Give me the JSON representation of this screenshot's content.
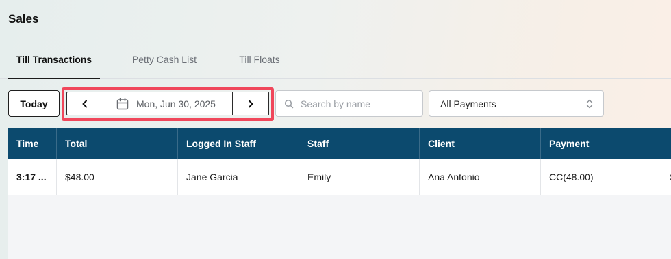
{
  "page": {
    "title": "Sales"
  },
  "tabs": [
    {
      "label": "Till Transactions",
      "active": true
    },
    {
      "label": "Petty Cash List",
      "active": false
    },
    {
      "label": "Till Floats",
      "active": false
    }
  ],
  "toolbar": {
    "today_label": "Today",
    "date_label": "Mon, Jun 30, 2025",
    "search_placeholder": "Search by name",
    "payment_filter": "All Payments",
    "highlight_color": "#f0475b"
  },
  "table": {
    "header_color": "#0c4a6e",
    "columns": [
      "Time",
      "Total",
      "Logged In Staff",
      "Staff",
      "Client",
      "Payment",
      ""
    ],
    "rows": [
      [
        "3:17 ...",
        "$48.00",
        "Jane Garcia",
        "Emily",
        "Ana Antonio",
        "CC(48.00)",
        "S"
      ]
    ]
  }
}
